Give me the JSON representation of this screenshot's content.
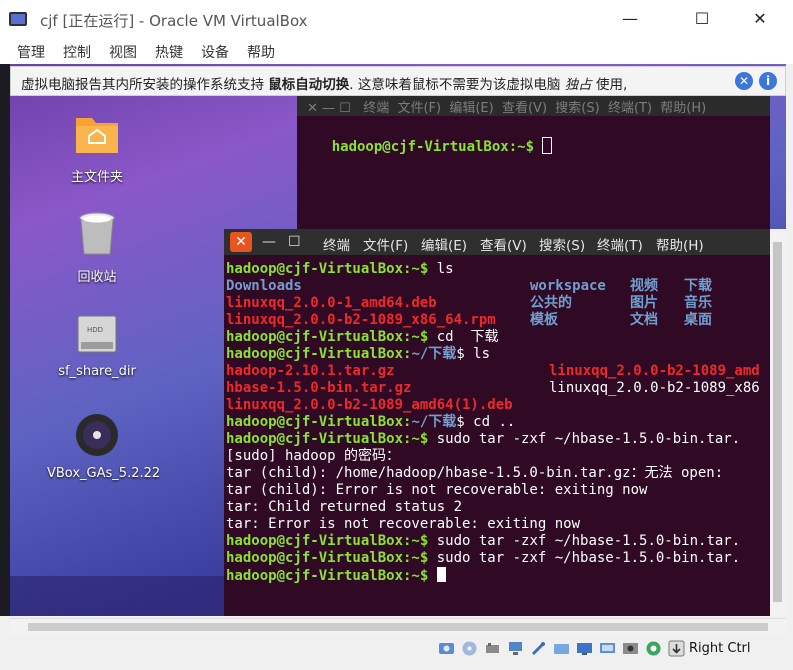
{
  "window": {
    "title": "cjf [正在运行] - Oracle VM VirtualBox",
    "min": "—",
    "max": "☐",
    "close": "✕"
  },
  "menubar": [
    "管理",
    "控制",
    "视图",
    "热键",
    "设备",
    "帮助"
  ],
  "notification": {
    "part1": "虚拟电脑报告其内所安装的操作系统支持",
    "bold": "鼠标自动切换",
    "part2": ". 这意味着鼠标不需要为该虚拟电脑",
    "italic": "独占",
    "part3": "使用,"
  },
  "desktop": {
    "icons": [
      {
        "label": "主文件夹",
        "icon": "home-folder-icon"
      },
      {
        "label": "回收站",
        "icon": "trash-icon"
      },
      {
        "label": "sf_share_dir",
        "icon": "hdd-icon"
      },
      {
        "label": "VBox_GAs_5.2.22",
        "icon": "cd-icon"
      }
    ]
  },
  "term_back": {
    "menu": "✕ — ☐   终端  文件(F)  编辑(E)  查看(V)  搜索(S)  终端(T)  帮助(H)",
    "prompt": "hadoop@cjf-VirtualBox:~$ "
  },
  "term_front": {
    "menus": [
      "终端",
      "文件(F)",
      "编辑(E)",
      "查看(V)",
      "搜索(S)",
      "终端(T)",
      "帮助(H)"
    ],
    "lines": {
      "l1_prompt": "hadoop@cjf-VirtualBox:~$",
      "l1_cmd": " ls",
      "l2_a": "Downloads",
      "l2_b": "workspace",
      "l2_c": "视频",
      "l2_d": "下载",
      "l3_a": "linuxqq_2.0.0-1_amd64.deb",
      "l3_b": "公共的",
      "l3_c": "图片",
      "l3_d": "音乐",
      "l4_a": "linuxqq_2.0.0-b2-1089_x86_64.rpm",
      "l4_b": "模板",
      "l4_c": "文档",
      "l4_d": "桌面",
      "l5_prompt": "hadoop@cjf-VirtualBox:~$",
      "l5_cmd": " cd  下载",
      "l6_prompt": "hadoop@cjf-VirtualBox:",
      "l6_path": "~/下载",
      "l6_cmd": "$ ls",
      "l7_a": "hadoop-2.10.1.tar.gz",
      "l7_b": "linuxqq_2.0.0-b2-1089_amd",
      "l8_a": "hbase-1.5.0-bin.tar.gz",
      "l8_b": "linuxqq_2.0.0-b2-1089_x86",
      "l9_a": "linuxqq_2.0.0-b2-1089_amd64(1).deb",
      "l10_prompt": "hadoop@cjf-VirtualBox:",
      "l10_path": "~/下载",
      "l10_cmd": "$ cd ..",
      "l11_prompt": "hadoop@cjf-VirtualBox:~$",
      "l11_cmd": " sudo tar -zxf ~/hbase-1.5.0-bin.tar.",
      "l12": "[sudo] hadoop 的密码：",
      "l13": "tar (child): /home/hadoop/hbase-1.5.0-bin.tar.gz：无法 open:",
      "l14": "tar (child): Error is not recoverable: exiting now",
      "l15": "tar: Child returned status 2",
      "l16": "tar: Error is not recoverable: exiting now",
      "l17_prompt": "hadoop@cjf-VirtualBox:~$",
      "l17_cmd": " sudo tar -zxf ~/hbase-1.5.0-bin.tar.",
      "l18_prompt": "hadoop@cjf-VirtualBox:~$",
      "l18_cmd": " sudo tar -zxf ~/hbase-1.5.0-bin.tar.",
      "l19_prompt": "hadoop@cjf-VirtualBox:~$",
      "l19_cmd": " "
    }
  },
  "statusbar": {
    "host_key": "Right Ctrl"
  },
  "colors": {
    "terminal_bg": "#300a24",
    "prompt_green": "#8ae234",
    "path_blue": "#729fcf",
    "archive_red": "#ef2929",
    "ubuntu_orange": "#e95420"
  }
}
